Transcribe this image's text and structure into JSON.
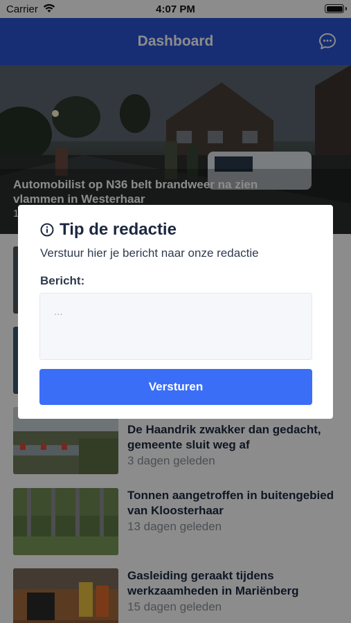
{
  "status_bar": {
    "carrier": "Carrier",
    "time": "4:07 PM"
  },
  "nav": {
    "title": "Dashboard",
    "chat_icon": "chat-bubble-icon"
  },
  "hero": {
    "title": "Automobilist op N36 belt brandweer na zien vlammen in Westerhaar",
    "date_visible": "1"
  },
  "articles": [
    {
      "title": "De Haandrik zwakker dan gedacht, gemeente sluit weg af",
      "date": "3 dagen geleden"
    },
    {
      "title": "Tonnen aangetroffen in buitengebied van Kloosterhaar",
      "date": "13 dagen geleden"
    },
    {
      "title": "Gasleiding geraakt tijdens werkzaamheden in Mariënberg",
      "date": "15 dagen geleden"
    }
  ],
  "modal": {
    "info_icon": "info-icon",
    "title": "Tip de redactie",
    "subtitle": "Verstuur hier je bericht naar onze redactie",
    "field_label": "Bericht:",
    "placeholder": "...",
    "submit_label": "Versturen"
  },
  "colors": {
    "nav": "#2b55d6",
    "button": "#3b6ef6",
    "text": "#1c2840"
  }
}
